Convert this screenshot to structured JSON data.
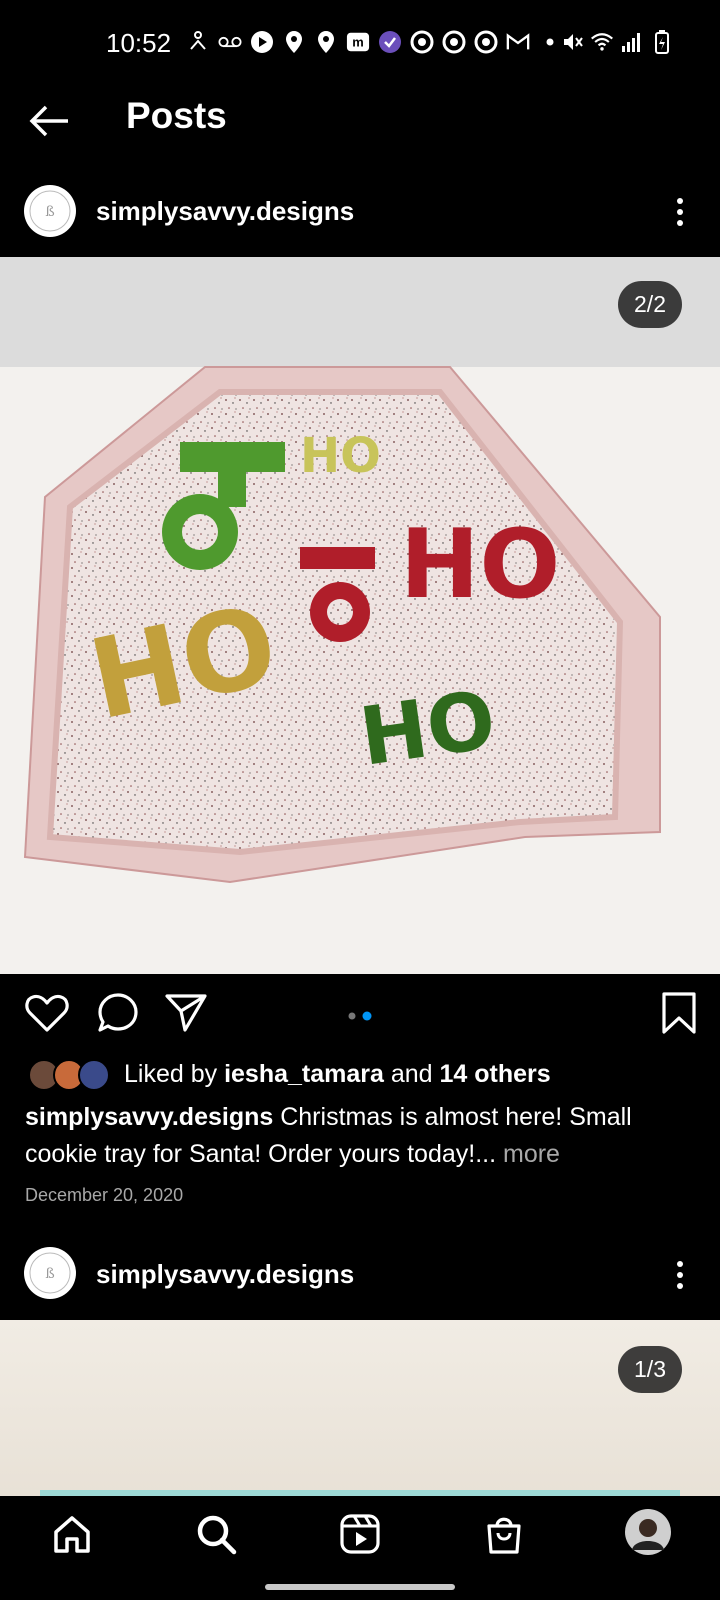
{
  "status_bar": {
    "time": "10:52"
  },
  "header": {
    "title": "Posts"
  },
  "post1": {
    "username": "simplysavvy.designs",
    "counter": "2/2",
    "carousel_index": 2,
    "carousel_total": 2,
    "liked_by_prefix": "Liked by ",
    "liked_by_user": "iesha_tamara",
    "liked_by_and": " and ",
    "liked_by_others": "14 others",
    "caption_user": "simplysavvy.designs",
    "caption_text": " Christmas is almost here! Small cookie tray for Santa! Order yours today!...",
    "caption_more": " more",
    "date": "December 20, 2020"
  },
  "post2": {
    "username": "simplysavvy.designs",
    "counter": "1/3"
  },
  "nav": {
    "items": [
      "home-icon",
      "search-icon",
      "reels-icon",
      "shop-icon",
      "profile-avatar"
    ]
  },
  "colors": {
    "accent_blue": "#0095f6",
    "background": "#000000",
    "muted": "#a8a8a8"
  }
}
